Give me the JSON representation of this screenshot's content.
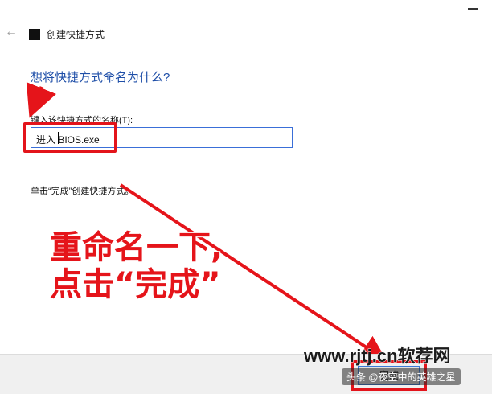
{
  "window": {
    "title": "创建快捷方式"
  },
  "main": {
    "heading": "想将快捷方式命名为什么?",
    "field_label": "键入该快捷方式的名称(T):",
    "name_value": "进入 BIOS.exe",
    "hint": "单击“完成”创建快捷方式。"
  },
  "footer": {
    "finish_label": "完成"
  },
  "annotation": {
    "line1": "重命名一下,",
    "line2": "点击“完成”"
  },
  "watermark": {
    "site": "www.rjtj.cn软荐网",
    "author": "头条 @夜空中的英雄之星"
  },
  "colors": {
    "annotation_red": "#e5141a",
    "heading_blue": "#1f4fa8",
    "focus_blue": "#3a6fd8"
  },
  "icons": {
    "back": "back-arrow-icon",
    "app": "shortcut-app-icon"
  }
}
